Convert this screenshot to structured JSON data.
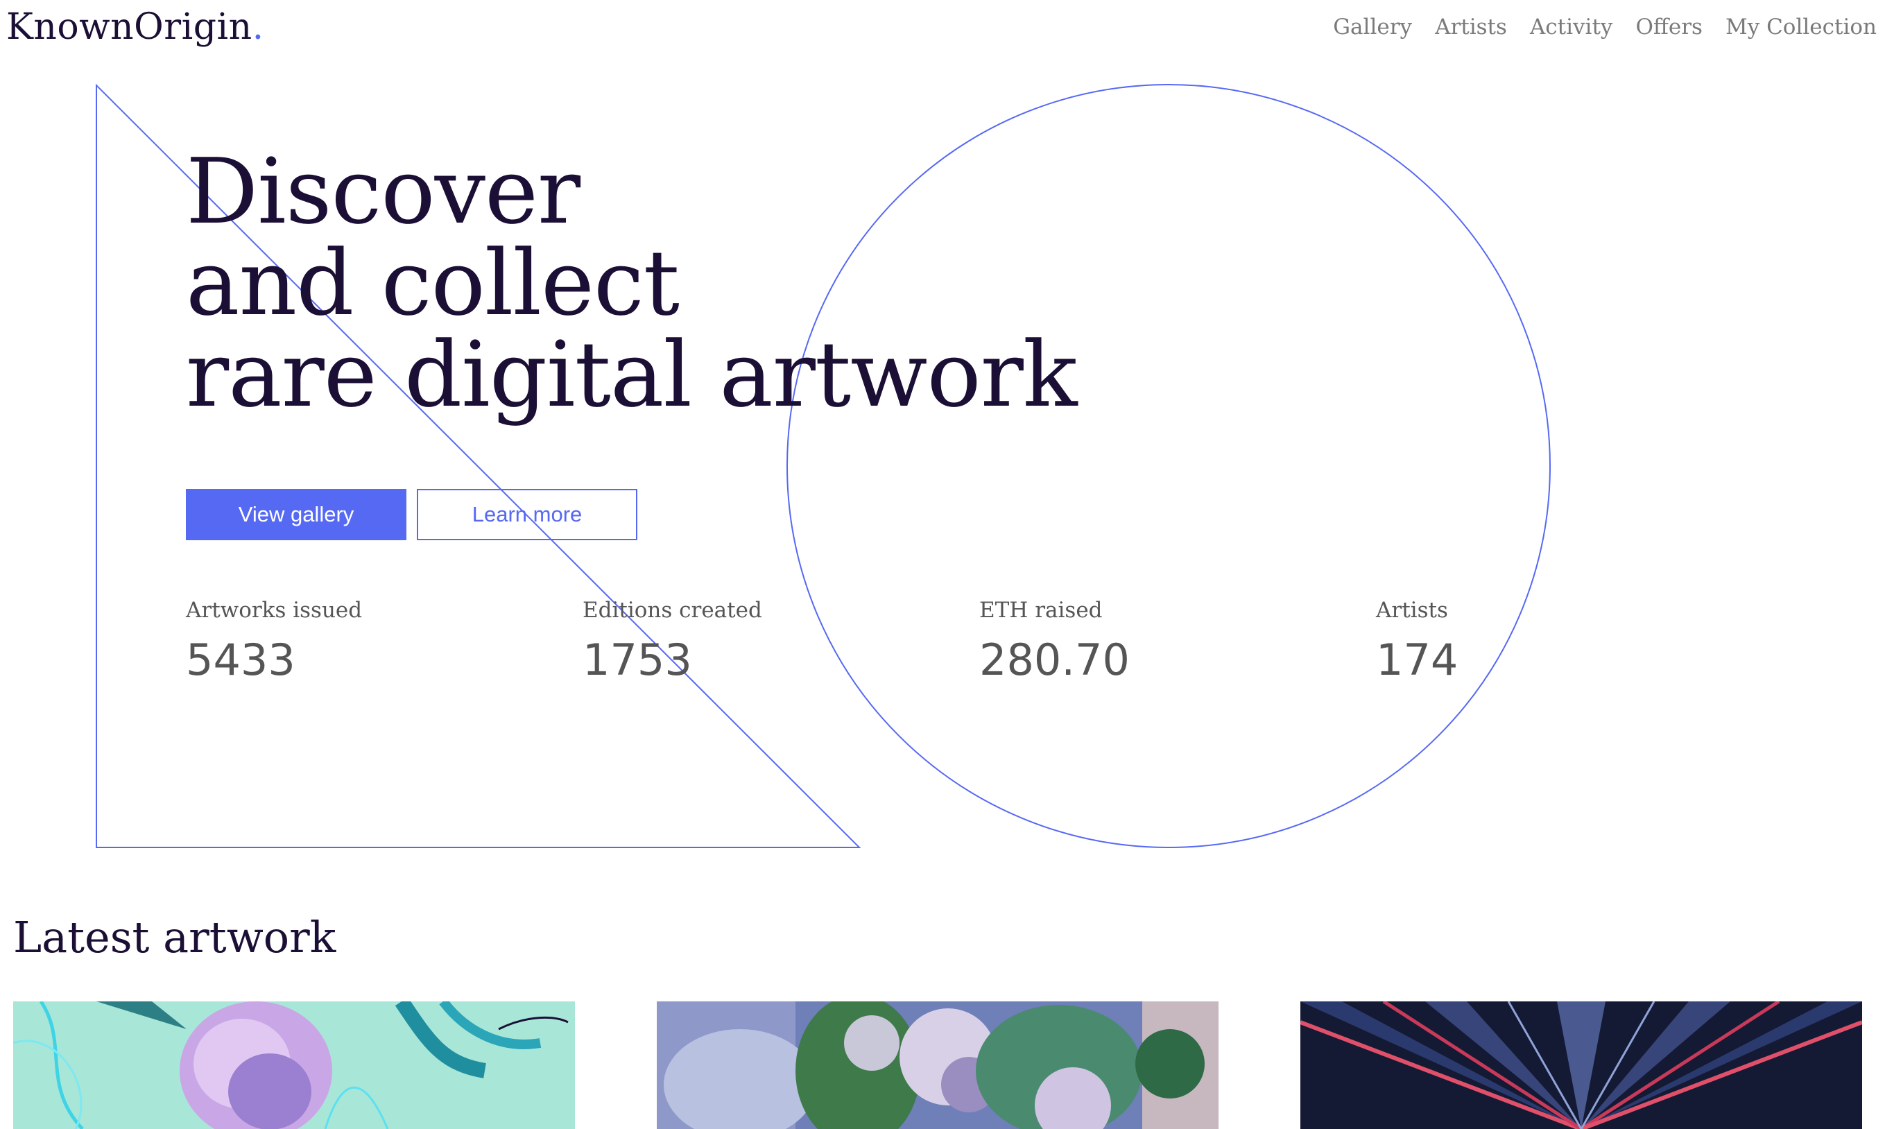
{
  "header": {
    "logo": "KnownOrigin",
    "logo_dot": ".",
    "nav": [
      "Gallery",
      "Artists",
      "Activity",
      "Offers",
      "My Collection"
    ]
  },
  "hero": {
    "lines": [
      "Discover",
      "and collect",
      "rare digital artwork"
    ],
    "primary_button": "View gallery",
    "secondary_button": "Learn more"
  },
  "stats": [
    {
      "label": "Artworks issued",
      "value": "5433"
    },
    {
      "label": "Editions created",
      "value": "1753"
    },
    {
      "label": "ETH raised",
      "value": "280.70"
    },
    {
      "label": "Artists",
      "value": "174"
    }
  ],
  "latest": {
    "title": "Latest artwork"
  },
  "colors": {
    "accent": "#5669f3",
    "text_dark": "#1b0f35",
    "text_muted": "#7a7a7a"
  }
}
